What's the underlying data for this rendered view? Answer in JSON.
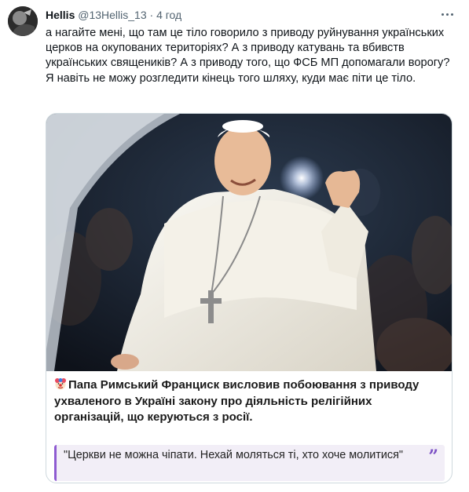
{
  "author": {
    "display_name": "Hellis",
    "handle": "@13Hellis_13",
    "separator": "·",
    "timestamp": "4 год"
  },
  "tweet": {
    "lines": [
      "а нагайте мені, що там це тіло говорило з приводу руйнування українських церков на окупованих територіях? А з приводу катувань та вбивств українських священиків? А з приводу того, що ФСБ МП допомагали ворогу?",
      "Я навіть не можу розгледити кінець того шляху, куди має піти це тіло."
    ]
  },
  "card": {
    "headline": "Папа Римський Франциск висловив побоювання з приводу ухваленого в Україні закону про діяльність релігійних організацій, що керуються з росії.",
    "quote": "\"Церкви не можна чіпати. Нехай моляться ті, хто хоче молитися\"",
    "quote_icon": "”",
    "icons": {
      "headline_emoji": "clown-face-icon",
      "more": "more-dots-icon"
    }
  },
  "colors": {
    "accent_purple": "#8e5bd1",
    "quote_bg": "#f2eef7",
    "secondary_text": "#536471",
    "border": "#cfd9de"
  }
}
